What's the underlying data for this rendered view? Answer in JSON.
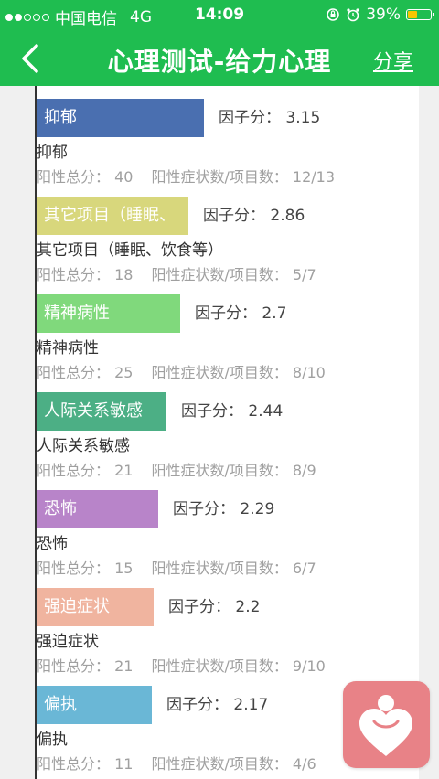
{
  "status": {
    "carrier": "中国电信",
    "network": "4G",
    "time": "14:09",
    "battery": "39%"
  },
  "nav": {
    "title": "心理测试-给力心理",
    "share": "分享"
  },
  "factor_label": "因子分：",
  "total_label": "阳性总分：",
  "count_label": "阳性症状数/项目数：",
  "items": [
    {
      "bar_label": "抑郁",
      "name": "抑郁",
      "factor": "3.15",
      "total": "40",
      "count": "12/13",
      "color": "#4a6fb0"
    },
    {
      "bar_label": "其它项目（睡眠、",
      "name": "其它项目（睡眠、饮食等）",
      "factor": "2.86",
      "total": "18",
      "count": "5/7",
      "color": "#d8d77c"
    },
    {
      "bar_label": "精神病性",
      "name": "精神病性",
      "factor": "2.7",
      "total": "25",
      "count": "8/10",
      "color": "#80d97c"
    },
    {
      "bar_label": "人际关系敏感",
      "name": "人际关系敏感",
      "factor": "2.44",
      "total": "21",
      "count": "8/9",
      "color": "#4caf85"
    },
    {
      "bar_label": "恐怖",
      "name": "恐怖",
      "factor": "2.29",
      "total": "15",
      "count": "6/7",
      "color": "#b884c9"
    },
    {
      "bar_label": "强迫症状",
      "name": "强迫症状",
      "factor": "2.2",
      "total": "21",
      "count": "9/10",
      "color": "#f0b49f"
    },
    {
      "bar_label": "偏执",
      "name": "偏执",
      "factor": "2.17",
      "total": "11",
      "count": "4/6",
      "color": "#6ab7d6"
    }
  ],
  "chart_data": {
    "type": "bar",
    "orientation": "horizontal",
    "categories": [
      "抑郁",
      "其它项目（睡眠、饮食等）",
      "精神病性",
      "人际关系敏感",
      "恐怖",
      "强迫症状",
      "偏执"
    ],
    "values": [
      3.15,
      2.86,
      2.7,
      2.44,
      2.29,
      2.2,
      2.17
    ],
    "title": "",
    "xlabel": "",
    "ylabel": ""
  },
  "fab_icon": "heart-person-icon"
}
